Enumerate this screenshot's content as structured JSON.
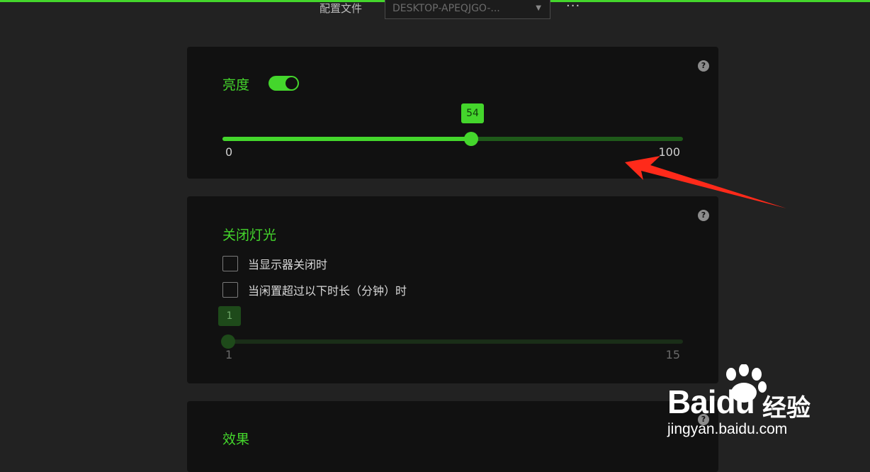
{
  "header": {
    "profile_label": "配置文件",
    "profile_value": "DESKTOP-APEQJGO-...",
    "more_label": "···"
  },
  "brightness": {
    "title": "亮度",
    "toggle_on": true,
    "value": 54,
    "value_text": "54",
    "min_label": "0",
    "max_label": "100",
    "help": "?"
  },
  "lights_off": {
    "title": "关闭灯光",
    "help": "?",
    "options": [
      {
        "label": "当显示器关闭时",
        "checked": false
      },
      {
        "label": "当闲置超过以下时长（分钟）时",
        "checked": false
      }
    ],
    "idle_value": 1,
    "idle_value_text": "1",
    "min_label": "1",
    "max_label": "15"
  },
  "effects": {
    "title": "效果",
    "help": "?"
  },
  "watermark": {
    "brand": "Baidu",
    "cn": "经验",
    "url": "jingyan.baidu.com"
  },
  "colors": {
    "accent": "#44d62c",
    "accent_dim": "#1f5a1a",
    "panel": "#111111",
    "background": "#222222",
    "arrow": "#ff2a1a"
  }
}
